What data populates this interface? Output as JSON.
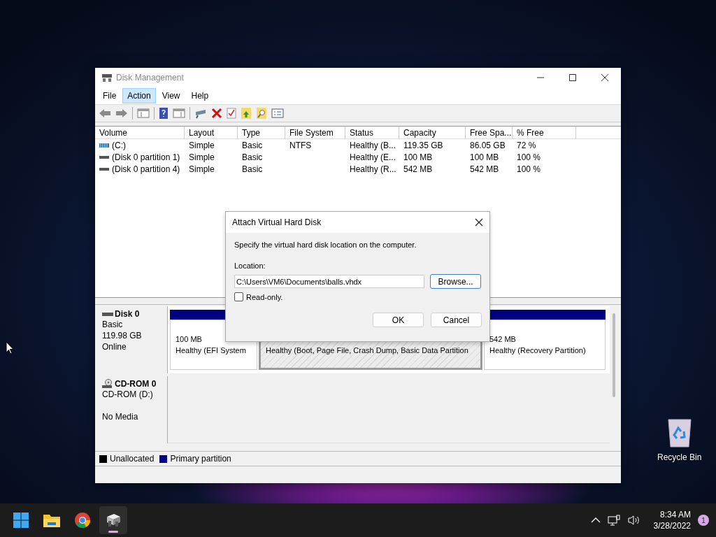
{
  "desktop": {
    "icons": [
      {
        "label": "Recycle Bin"
      }
    ]
  },
  "window": {
    "title": "Disk Management"
  },
  "menu": [
    {
      "label": "File",
      "selected": false
    },
    {
      "label": "Action",
      "selected": true
    },
    {
      "label": "View",
      "selected": false
    },
    {
      "label": "Help",
      "selected": false
    }
  ],
  "table": {
    "columns": [
      "Volume",
      "Layout",
      "Type",
      "File System",
      "Status",
      "Capacity",
      "Free Spa...",
      "% Free"
    ],
    "rows": [
      {
        "kind": "system",
        "cells": [
          "(C:)",
          "Simple",
          "Basic",
          "NTFS",
          "Healthy (B...",
          "119.35 GB",
          "86.05 GB",
          "72 %"
        ]
      },
      {
        "kind": "partition",
        "cells": [
          "(Disk 0 partition 1)",
          "Simple",
          "Basic",
          "",
          "Healthy (E...",
          "100 MB",
          "100 MB",
          "100 %"
        ]
      },
      {
        "kind": "partition",
        "cells": [
          "(Disk 0 partition 4)",
          "Simple",
          "Basic",
          "",
          "Healthy (R...",
          "542 MB",
          "542 MB",
          "100 %"
        ]
      }
    ]
  },
  "disks": [
    {
      "kind": "disk",
      "name": "Disk 0",
      "type": "Basic",
      "size": "119.98 GB",
      "status": "Online",
      "partitions": [
        {
          "size": "100 MB",
          "status": "Healthy (EFI System",
          "selected": false
        },
        {
          "status": "Healthy (Boot, Page File, Crash Dump, Basic Data Partition",
          "selected": true
        },
        {
          "size": "542 MB",
          "status": "Healthy (Recovery Partition)",
          "selected": false
        }
      ]
    },
    {
      "kind": "cdrom",
      "name": "CD-ROM 0",
      "type": "CD-ROM (D:)",
      "status": "No Media"
    }
  ],
  "legend": [
    {
      "label": "Unallocated",
      "color": "#000000"
    },
    {
      "label": "Primary partition",
      "color": "#000080"
    }
  ],
  "dialog": {
    "title": "Attach Virtual Hard Disk",
    "instruction": "Specify the virtual hard disk location on the computer.",
    "location_label": "Location:",
    "location_value": "C:\\Users\\VM6\\Documents\\balls.vhdx",
    "browse": "Browse...",
    "read_only": {
      "label": "Read-only.",
      "checked": false
    },
    "buttons": [
      "OK",
      "Cancel"
    ]
  },
  "taskbar": {
    "apps": [
      {
        "kind": "start",
        "selected": false
      },
      {
        "kind": "folder",
        "selected": false
      },
      {
        "kind": "browser",
        "selected": false
      },
      {
        "kind": "disk",
        "selected": true
      }
    ],
    "time": "8:34 AM",
    "date": "3/28/2022",
    "notifications": "1"
  }
}
